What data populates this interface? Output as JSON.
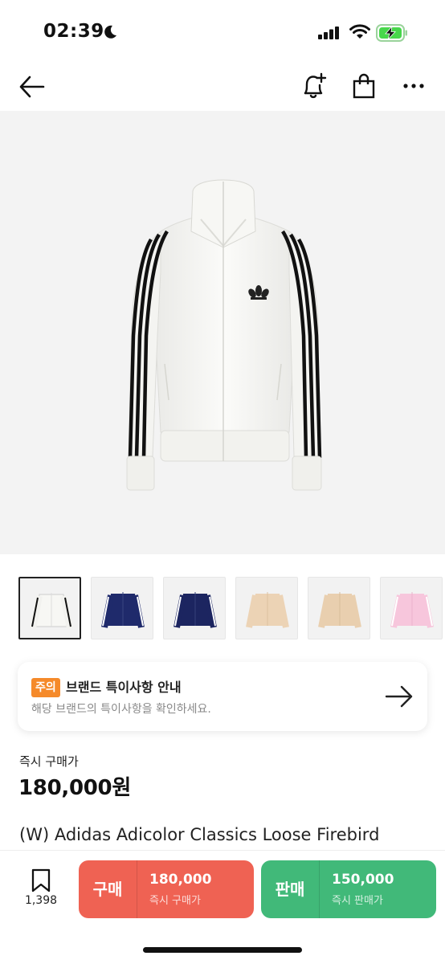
{
  "status_bar": {
    "time": "02:39"
  },
  "nav": {
    "back_icon": "arrow-left-icon",
    "alert_icon": "bell-plus-icon",
    "bag_icon": "shopping-bag-icon",
    "more_icon": "more-horizontal-icon"
  },
  "thumbnails": [
    {
      "color": "white",
      "selected": true
    },
    {
      "color": "navy",
      "selected": false
    },
    {
      "color": "navy",
      "selected": false
    },
    {
      "color": "beige",
      "selected": false
    },
    {
      "color": "beige",
      "selected": false
    },
    {
      "color": "pink",
      "selected": false
    }
  ],
  "notice": {
    "badge": "주의",
    "title": "브랜드 특이사항 안내",
    "description": "해당 브랜드의 특이사항을 확인하세요."
  },
  "price": {
    "label": "즉시 구매가",
    "value": "180,000원"
  },
  "product": {
    "name": "(W) Adidas Adicolor Classics Loose Firebird"
  },
  "bottom_bar": {
    "wish_count": "1,398",
    "buy": {
      "label": "구매",
      "price": "180,000",
      "sub": "즉시 구매가"
    },
    "sell": {
      "label": "판매",
      "price": "150,000",
      "sub": "즉시 판매가"
    }
  },
  "colors": {
    "buy": "#ef6253",
    "sell": "#41b979",
    "badge": "#f58a2a"
  }
}
